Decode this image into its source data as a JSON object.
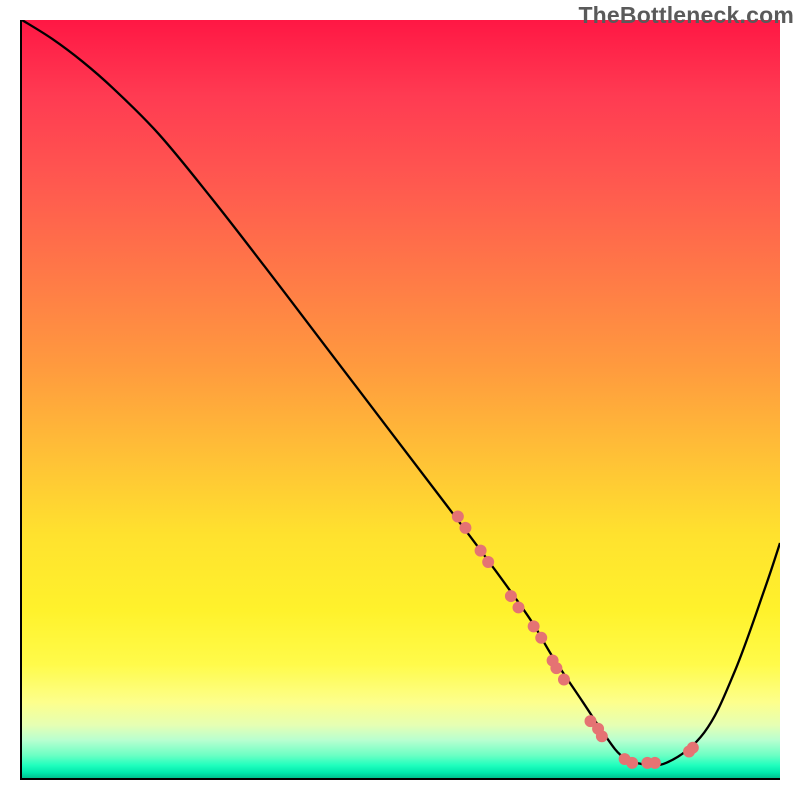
{
  "watermark": "TheBottleneck.com",
  "chart_data": {
    "type": "line",
    "title": "",
    "xlabel": "",
    "ylabel": "",
    "xlim": [
      0,
      100
    ],
    "ylim": [
      0,
      100
    ],
    "grid": false,
    "series": [
      {
        "name": "curve",
        "color": "#000000",
        "x": [
          0,
          4,
          8,
          12,
          18,
          25,
          32,
          40,
          48,
          56,
          62,
          67,
          70,
          74,
          77,
          79,
          81,
          85,
          90,
          94,
          98,
          100
        ],
        "y": [
          100,
          97.5,
          94.5,
          91,
          85,
          76.5,
          67.5,
          57,
          46.5,
          36,
          28,
          21,
          16,
          10,
          5.5,
          3,
          2,
          2,
          6,
          14,
          25,
          31
        ]
      }
    ],
    "points": [
      {
        "x": 57.5,
        "y": 34.5
      },
      {
        "x": 58.5,
        "y": 33
      },
      {
        "x": 60.5,
        "y": 30
      },
      {
        "x": 61.5,
        "y": 28.5
      },
      {
        "x": 64.5,
        "y": 24
      },
      {
        "x": 65.5,
        "y": 22.5
      },
      {
        "x": 67.5,
        "y": 20
      },
      {
        "x": 68.5,
        "y": 18.5
      },
      {
        "x": 70,
        "y": 15.5
      },
      {
        "x": 70.5,
        "y": 14.5
      },
      {
        "x": 71.5,
        "y": 13
      },
      {
        "x": 75,
        "y": 7.5
      },
      {
        "x": 76,
        "y": 6.5
      },
      {
        "x": 76.5,
        "y": 5.5
      },
      {
        "x": 79.5,
        "y": 2.5
      },
      {
        "x": 80.5,
        "y": 2
      },
      {
        "x": 82.5,
        "y": 2
      },
      {
        "x": 83.5,
        "y": 2
      },
      {
        "x": 88,
        "y": 3.5
      },
      {
        "x": 88.5,
        "y": 4
      }
    ],
    "point_color": "#e57373",
    "point_radius": 6
  }
}
